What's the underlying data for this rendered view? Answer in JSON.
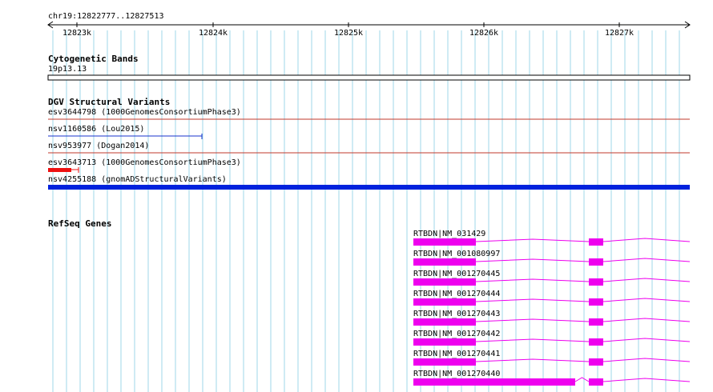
{
  "region": {
    "label": "chr19:12822777..12827513",
    "ticks": [
      "12823k",
      "12824k",
      "12825k",
      "12826k",
      "12827k"
    ],
    "tick_values_bp": [
      12823000,
      12824000,
      12825000,
      12826000,
      12827000
    ]
  },
  "cytoband": {
    "title": "Cytogenetic Bands",
    "band": "19p13.13"
  },
  "dgv": {
    "title": "DGV Structural Variants",
    "variants": [
      {
        "label": "esv3644798 (1000GenomesConsortiumPhase3)",
        "style": "thin-line",
        "color": "#c0392b"
      },
      {
        "label": "nsv1160586 (Lou2015)",
        "style": "thin-line",
        "color": "#1a33cc"
      },
      {
        "label": "nsv953977 (Dogan2014)",
        "style": "thin-line",
        "color": "#c0392b"
      },
      {
        "label": "esv3643713 (1000GenomesConsortiumPhase3)",
        "style": "block",
        "color": "#ee1111"
      },
      {
        "label": "nsv4255188 (gnomADStructuralVariants)",
        "style": "thick-bar",
        "color": "#0022dd"
      }
    ]
  },
  "refseq": {
    "title": "RefSeq Genes",
    "color": "#ee00ee",
    "genes": [
      "RTBDN|NM_031429",
      "RTBDN|NM_001080997",
      "RTBDN|NM_001270445",
      "RTBDN|NM_001270444",
      "RTBDN|NM_001270443",
      "RTBDN|NM_001270442",
      "RTBDN|NM_001270441",
      "RTBDN|NM_001270440"
    ]
  },
  "colors": {
    "grid": "#9fd7ea",
    "ruler": "#000000",
    "background": "#ffffff"
  }
}
